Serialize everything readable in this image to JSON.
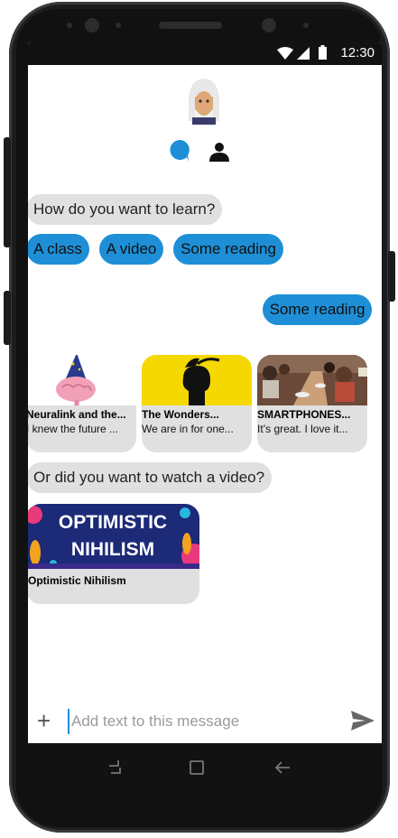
{
  "status_bar": {
    "time": "12:30"
  },
  "prompt_question": "How do you want to learn?",
  "options": [
    "A class",
    "A video",
    "Some reading"
  ],
  "user_reply": "Some reading",
  "cards": [
    {
      "title": "Neuralink and the...",
      "description": "I knew the future ..."
    },
    {
      "title": "The Wonders...",
      "description": "We are in for one..."
    },
    {
      "title": "SMARTPHONES...",
      "description": "It’s great. I love it..."
    }
  ],
  "followup_question": "Or did you want to watch a video?",
  "video": {
    "thumb_line1": "OPTIMISTIC",
    "thumb_line2": "NIHILISM",
    "title": "Optimistic Nihilism"
  },
  "composer": {
    "placeholder": "Add text to this message",
    "plus_label": "+"
  },
  "colors": {
    "accent": "#1e8fd6",
    "bubble": "#e0e0e0",
    "bars": "#121212"
  }
}
